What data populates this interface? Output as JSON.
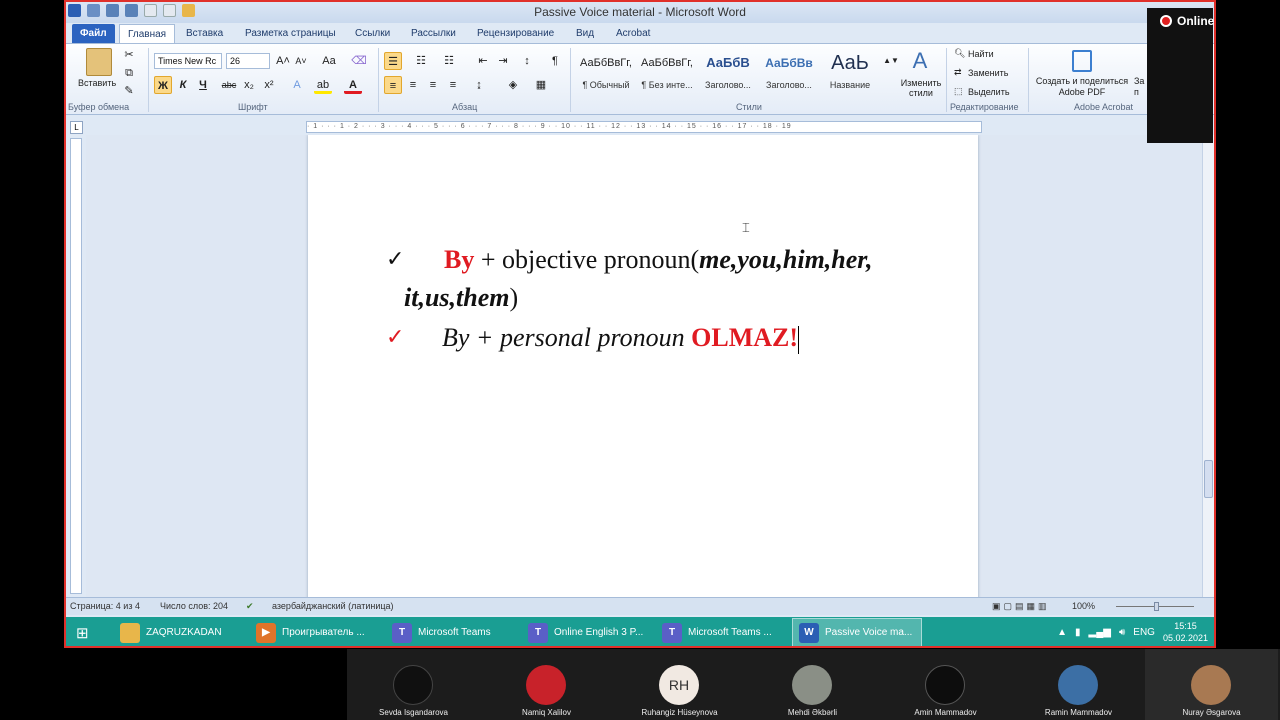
{
  "window": {
    "title": "Passive Voice  material  -  Microsoft Word"
  },
  "tabs": [
    "Файл",
    "Главная",
    "Вставка",
    "Разметка страницы",
    "Ссылки",
    "Рассылки",
    "Рецензирование",
    "Вид",
    "Acrobat"
  ],
  "ribbon": {
    "clipboard": {
      "paste_label": "Вставить",
      "group": "Буфер обмена"
    },
    "font": {
      "family": "Times New Rc",
      "size": "26",
      "group": "Шрифт",
      "bold": "Ж",
      "italic": "К",
      "underline": "Ч",
      "strike": "abc",
      "sub": "x₂",
      "sup": "x²"
    },
    "paragraph": {
      "group": "Абзац"
    },
    "styles": {
      "group": "Стили",
      "items": [
        {
          "sample": "АаБбВвГг,",
          "name": "¶ Обычный"
        },
        {
          "sample": "АаБбВвГг,",
          "name": "¶ Без инте..."
        },
        {
          "sample": "АаБбВ",
          "name": "Заголово..."
        },
        {
          "sample": "АаБбВв",
          "name": "Заголово..."
        },
        {
          "sample": "АаЬ",
          "name": "Название"
        }
      ],
      "change_label": "Изменить стили"
    },
    "editing": {
      "group": "Редактирование",
      "find": "Найти",
      "replace": "Заменить",
      "select": "Выделить"
    },
    "acrobat": {
      "group": "Adobe Acrobat",
      "create_label": "Создать и поделиться Adobe PDF",
      "extra": "За п"
    }
  },
  "document": {
    "line1_by": "By",
    "line1_rest": " + objective pronoun(",
    "line1_pronouns": "me,you,him,her,",
    "line2_pronouns": "it,us,them",
    "line2_close": ")",
    "line3_by": "By",
    "line3_rest": " + personal pronoun ",
    "line3_olmaz": "OLMAZ!"
  },
  "status": {
    "page": "Страница: 4 из 4",
    "words": "Число слов: 204",
    "language": "азербайджанский (латиница)",
    "zoom": "100%"
  },
  "taskbar": {
    "items": [
      {
        "label": "ZAQRUZKADAN",
        "icon": "folder-icon",
        "color": "#e8b64a"
      },
      {
        "label": "Проигрыватель ...",
        "icon": "media-player-icon",
        "color": "#e0742a"
      },
      {
        "label": "Microsoft Teams",
        "icon": "teams-icon",
        "color": "#5a5fc7"
      },
      {
        "label": "Online English 3 P...",
        "icon": "teams-icon",
        "color": "#5a5fc7"
      },
      {
        "label": "Microsoft Teams ...",
        "icon": "teams-icon",
        "color": "#5a5fc7"
      },
      {
        "label": "Passive Voice  ma...",
        "icon": "word-icon",
        "color": "#2b5fb4"
      }
    ],
    "lang": "ENG",
    "time": "15:15",
    "date": "05.02.2021"
  },
  "recording": {
    "label": "Online"
  },
  "participants": [
    {
      "name": "Sevda Isgandarova",
      "initials": "",
      "bg": "#101010"
    },
    {
      "name": "Namiq Xalilov",
      "initials": "",
      "bg": "#c8222a"
    },
    {
      "name": "Ruhangiz Hüseynova",
      "initials": "RH",
      "bg": "#f1e9e2"
    },
    {
      "name": "Mehdi Əkbərli",
      "initials": "",
      "bg": "#8a8f86"
    },
    {
      "name": "Amin Mammadov",
      "initials": "",
      "bg": "#0d0d0d"
    },
    {
      "name": "Ramin Mammadov",
      "initials": "",
      "bg": "#3c6fa5"
    },
    {
      "name": "Nuray Əsgarova",
      "initials": "",
      "bg": "#a87952"
    }
  ]
}
